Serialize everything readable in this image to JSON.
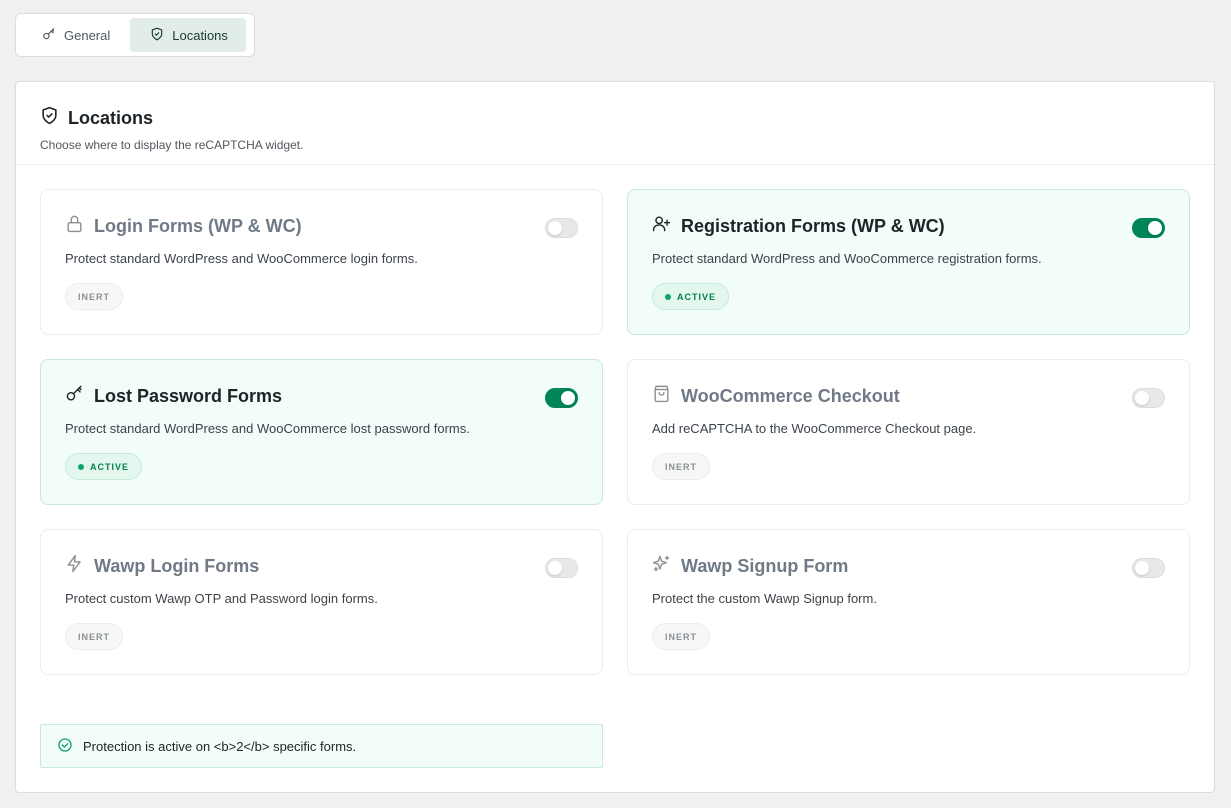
{
  "tabs": [
    {
      "label": "General",
      "icon": "key-icon",
      "active": false
    },
    {
      "label": "Locations",
      "icon": "shield-check-icon",
      "active": true
    }
  ],
  "panel": {
    "title": "Locations",
    "subtitle": "Choose where to display the reCAPTCHA widget."
  },
  "cards": [
    {
      "title": "Login Forms (WP & WC)",
      "icon": "lock-icon",
      "description": "Protect standard WordPress and WooCommerce login forms.",
      "badge": "INERT",
      "enabled": false
    },
    {
      "title": "Registration Forms (WP & WC)",
      "icon": "user-plus-icon",
      "description": "Protect standard WordPress and WooCommerce registration forms.",
      "badge": "ACTIVE",
      "enabled": true
    },
    {
      "title": "Lost Password Forms",
      "icon": "key-icon",
      "description": "Protect standard WordPress and WooCommerce lost password forms.",
      "badge": "ACTIVE",
      "enabled": true
    },
    {
      "title": "WooCommerce Checkout",
      "icon": "shopping-bag-icon",
      "description": "Add reCAPTCHA to the WooCommerce Checkout page.",
      "badge": "INERT",
      "enabled": false
    },
    {
      "title": "Wawp Login Forms",
      "icon": "zap-icon",
      "description": "Protect custom Wawp OTP and Password login forms.",
      "badge": "INERT",
      "enabled": false
    },
    {
      "title": "Wawp Signup Form",
      "icon": "sparkles-icon",
      "description": "Protect the custom Wawp Signup form.",
      "badge": "INERT",
      "enabled": false
    }
  ],
  "status": {
    "text": "Protection is active on <b>2</b> specific forms.",
    "icon": "check-circle-icon"
  },
  "colors": {
    "accent": "#008556",
    "active_bg": "#f2fcf8",
    "active_border": "#c6ebdb"
  }
}
